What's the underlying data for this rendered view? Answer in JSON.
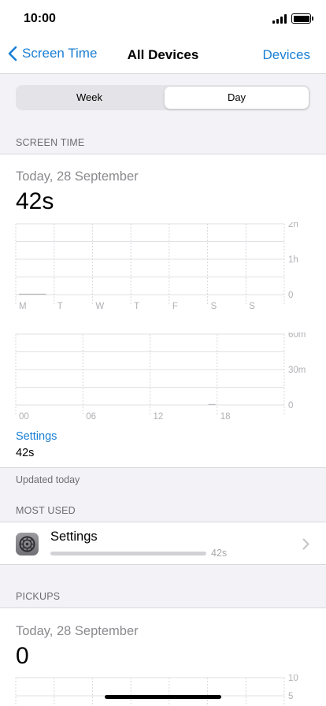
{
  "status": {
    "time": "10:00"
  },
  "nav": {
    "back_label": "Screen Time",
    "title": "All Devices",
    "right_label": "Devices"
  },
  "segments": {
    "week": "Week",
    "day": "Day",
    "selected": "Day"
  },
  "screen_time": {
    "header": "SCREEN TIME",
    "date": "Today, 28 September",
    "total": "42s",
    "app_name": "Settings",
    "app_time": "42s",
    "updated": "Updated today"
  },
  "most_used": {
    "header": "MOST USED",
    "items": [
      {
        "name": "Settings",
        "time": "42s",
        "icon": "gear-icon"
      }
    ]
  },
  "pickups": {
    "header": "PICKUPS",
    "date": "Today, 28 September",
    "total": "0"
  },
  "chart_data": [
    {
      "type": "bar",
      "categories": [
        "M",
        "T",
        "W",
        "T",
        "F",
        "S",
        "S"
      ],
      "y_ticks": [
        "2h",
        "1h",
        "0"
      ],
      "values_seconds": [
        42,
        0,
        0,
        0,
        0,
        0,
        0
      ],
      "ylim_seconds": [
        0,
        7200
      ]
    },
    {
      "type": "bar",
      "x_ticks": [
        "00",
        "06",
        "12",
        "18"
      ],
      "y_ticks": [
        "60m",
        "30m",
        "0"
      ],
      "hours": [
        17
      ],
      "values_seconds": [
        42
      ],
      "ylim_seconds": [
        0,
        3600
      ]
    },
    {
      "type": "bar",
      "y_ticks": [
        "10",
        "5"
      ],
      "values": [
        0
      ],
      "ylim": [
        0,
        10
      ]
    }
  ]
}
